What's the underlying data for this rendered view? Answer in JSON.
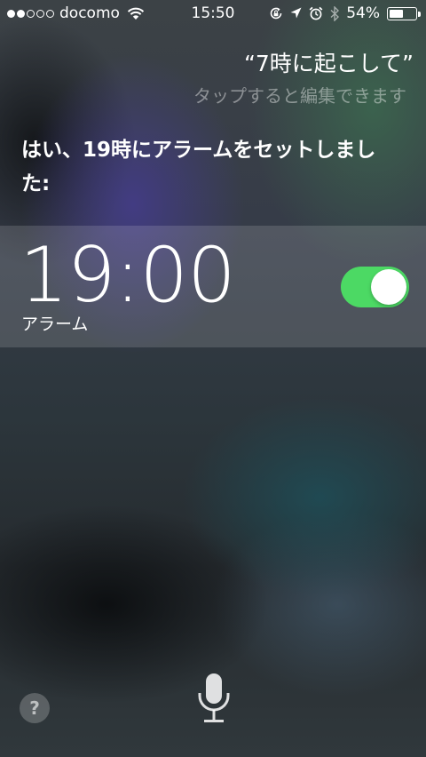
{
  "status_bar": {
    "signal_full": 2,
    "signal_total": 5,
    "carrier": "docomo",
    "time": "15:50",
    "battery_percent_text": "54%",
    "battery_level": 0.54,
    "icons": [
      "wifi-icon",
      "rotation-lock-icon",
      "location-icon",
      "alarm-icon",
      "bluetooth-icon",
      "battery-icon"
    ]
  },
  "siri": {
    "query": "“7時に起こして”",
    "edit_hint": "タップすると編集できます",
    "response": "はい、19時にアラームをセットしました:"
  },
  "alarm": {
    "time": "19:00",
    "label": "アラーム",
    "enabled": true,
    "toggle_color": "#4cd964"
  },
  "bottom": {
    "help_label": "?",
    "icons": [
      "help-icon",
      "microphone-icon"
    ]
  }
}
